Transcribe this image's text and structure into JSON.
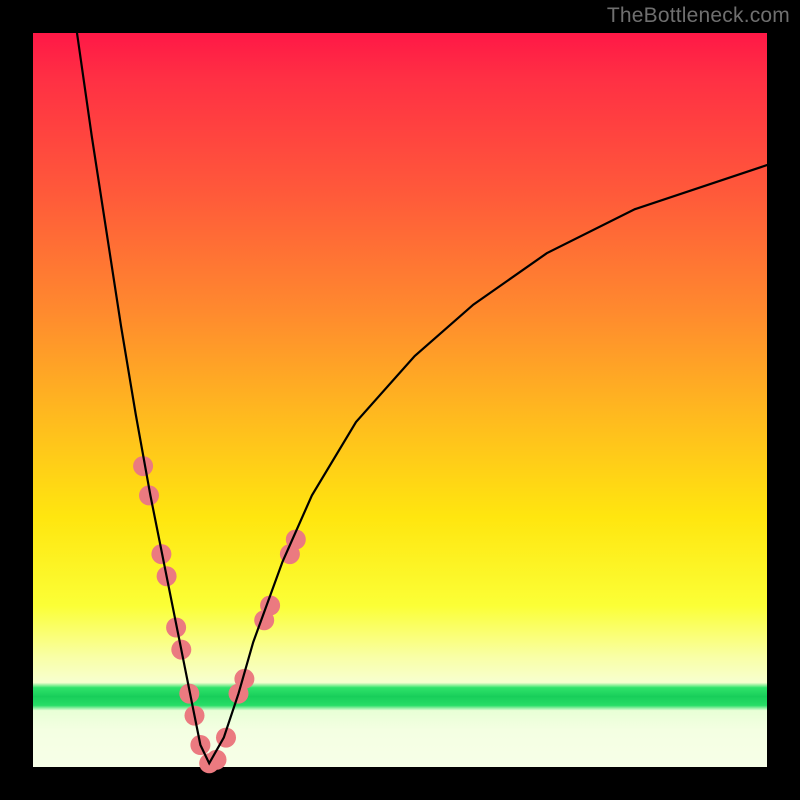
{
  "watermark": "TheBottleneck.com",
  "chart_data": {
    "type": "line",
    "title": "",
    "xlabel": "",
    "ylabel": "",
    "xlim": [
      0,
      100
    ],
    "ylim": [
      0,
      100
    ],
    "grid": false,
    "series": [
      {
        "name": "bottleneck-curve",
        "x": [
          6,
          8,
          10,
          12,
          14,
          16,
          18,
          20,
          22,
          22.8,
          24,
          26,
          28,
          30,
          34,
          38,
          44,
          52,
          60,
          70,
          82,
          100
        ],
        "y": [
          100,
          86,
          73,
          60,
          48,
          37,
          27,
          17,
          7,
          3,
          0.5,
          4,
          10,
          17,
          28,
          37,
          47,
          56,
          63,
          70,
          76,
          82
        ]
      }
    ],
    "markers": {
      "name": "highlight-dots",
      "color": "#eb7a80",
      "radius_px": 10,
      "points_xy": [
        [
          15.0,
          41
        ],
        [
          15.8,
          37
        ],
        [
          17.5,
          29
        ],
        [
          18.2,
          26
        ],
        [
          19.5,
          19
        ],
        [
          20.2,
          16
        ],
        [
          21.3,
          10
        ],
        [
          22.0,
          7
        ],
        [
          22.8,
          3
        ],
        [
          24.0,
          0.5
        ],
        [
          25.0,
          1
        ],
        [
          26.3,
          4
        ],
        [
          28.0,
          10
        ],
        [
          28.8,
          12
        ],
        [
          31.5,
          20
        ],
        [
          32.3,
          22
        ],
        [
          35.0,
          29
        ],
        [
          35.8,
          31
        ]
      ]
    },
    "gradient_stops": [
      {
        "pos": 0.0,
        "color": "#ff1846"
      },
      {
        "pos": 0.22,
        "color": "#ff5a3a"
      },
      {
        "pos": 0.52,
        "color": "#ffb91f"
      },
      {
        "pos": 0.78,
        "color": "#fbff36"
      },
      {
        "pos": 0.885,
        "color": "#f7ffd0"
      },
      {
        "pos": 0.904,
        "color": "#18ce5a"
      },
      {
        "pos": 0.923,
        "color": "#e8ffd6"
      },
      {
        "pos": 1.0,
        "color": "#f7ffe8"
      }
    ]
  }
}
